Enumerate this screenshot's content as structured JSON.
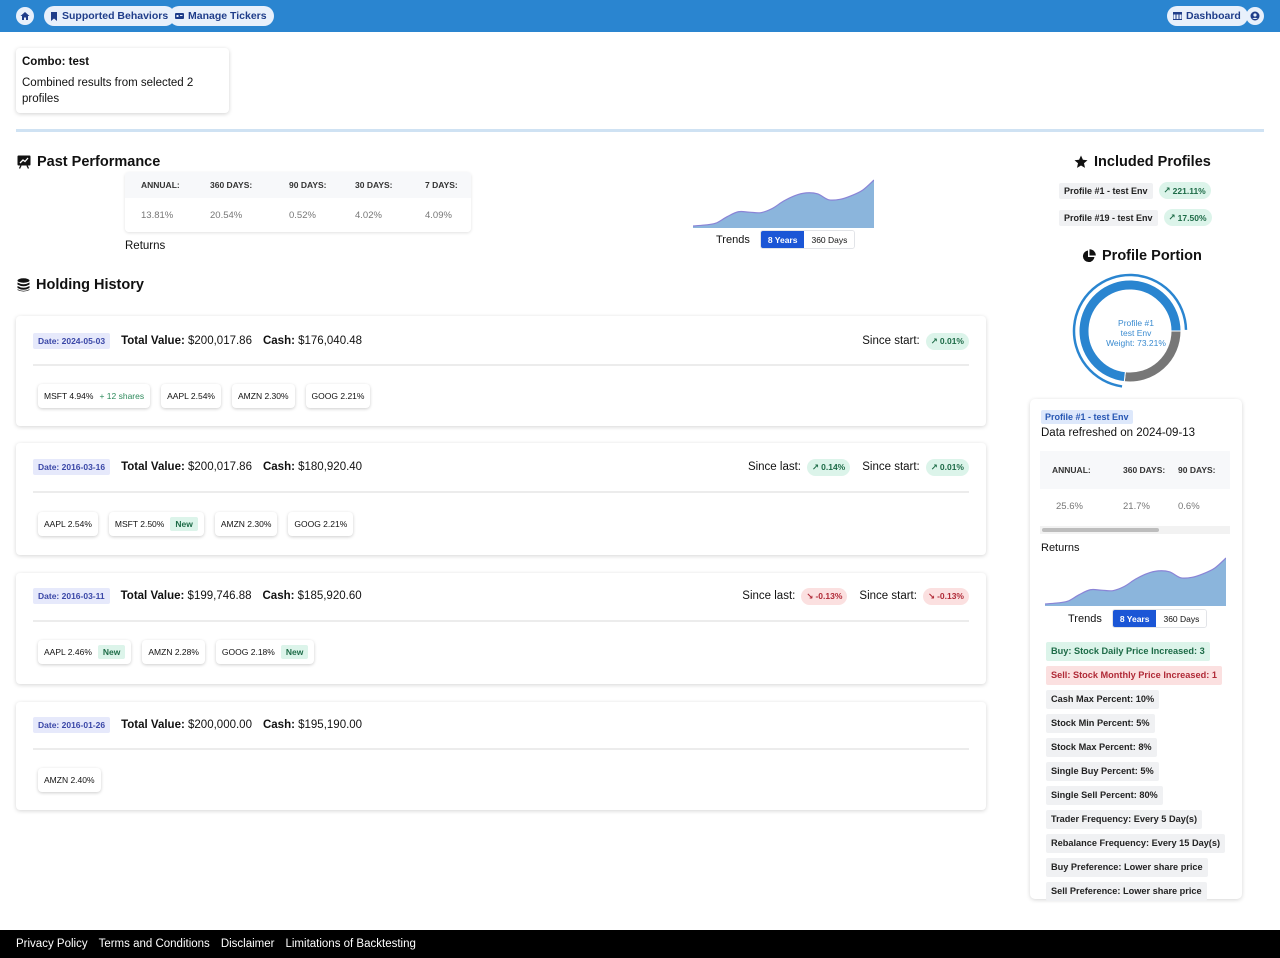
{
  "nav": {
    "home_icon": "home-icon",
    "supported_behaviors": "Supported Behaviors",
    "manage_tickers": "Manage Tickers",
    "dashboard": "Dashboard",
    "account_icon": "user-circle-icon"
  },
  "combo": {
    "title": "Combo: test",
    "description": "Combined results from selected 2 profiles"
  },
  "past_performance": {
    "title": "Past Performance",
    "columns": [
      "ANNUAL:",
      "360 DAYS:",
      "90 DAYS:",
      "30 DAYS:",
      "7 DAYS:"
    ],
    "values": [
      "13.81%",
      "20.54%",
      "0.52%",
      "4.02%",
      "4.09%"
    ],
    "returns_label": "Returns",
    "trends_label": "Trends",
    "trend_options": [
      "8 Years",
      "360 Days"
    ],
    "trend_selected": "8 Years",
    "sparkline": [
      0.0,
      0.02,
      0.06,
      0.2,
      0.31,
      0.3,
      0.29,
      0.38,
      0.54,
      0.66,
      0.72,
      0.7,
      0.57,
      0.58,
      0.66,
      0.78,
      1.0
    ]
  },
  "holding_history": {
    "title": "Holding History",
    "entries": [
      {
        "date": "Date: 2024-05-03",
        "total_value_label": "Total Value:",
        "total_value": "$200,017.86",
        "cash_label": "Cash:",
        "cash": "$176,040.48",
        "since_last": null,
        "since_start": {
          "label": "Since start:",
          "value": "0.01%",
          "direction": "up"
        },
        "holdings": [
          {
            "text": "MSFT 4.94%",
            "note": "+ 12 shares"
          },
          {
            "text": "AAPL 2.54%"
          },
          {
            "text": "AMZN 2.30%"
          },
          {
            "text": "GOOG 2.21%"
          }
        ]
      },
      {
        "date": "Date: 2016-03-16",
        "total_value_label": "Total Value:",
        "total_value": "$200,017.86",
        "cash_label": "Cash:",
        "cash": "$180,920.40",
        "since_last": {
          "label": "Since last:",
          "value": "0.14%",
          "direction": "up"
        },
        "since_start": {
          "label": "Since start:",
          "value": "0.01%",
          "direction": "up"
        },
        "holdings": [
          {
            "text": "AAPL 2.54%"
          },
          {
            "text": "MSFT 2.50%",
            "badge": "New"
          },
          {
            "text": "AMZN 2.30%"
          },
          {
            "text": "GOOG 2.21%"
          }
        ]
      },
      {
        "date": "Date: 2016-03-11",
        "total_value_label": "Total Value:",
        "total_value": "$199,746.88",
        "cash_label": "Cash:",
        "cash": "$185,920.60",
        "since_last": {
          "label": "Since last:",
          "value": "-0.13%",
          "direction": "down"
        },
        "since_start": {
          "label": "Since start:",
          "value": "-0.13%",
          "direction": "down"
        },
        "holdings": [
          {
            "text": "AAPL 2.46%",
            "badge": "New"
          },
          {
            "text": "AMZN 2.28%"
          },
          {
            "text": "GOOG 2.18%",
            "badge": "New"
          }
        ]
      },
      {
        "date": "Date: 2016-01-26",
        "total_value_label": "Total Value:",
        "total_value": "$200,000.00",
        "cash_label": "Cash:",
        "cash": "$195,190.00",
        "since_last": null,
        "since_start": null,
        "holdings": [
          {
            "text": "AMZN 2.40%"
          }
        ]
      }
    ]
  },
  "included_profiles": {
    "title": "Included Profiles",
    "items": [
      {
        "name": "Profile #1 - test Env",
        "return": "221.11%"
      },
      {
        "name": "Profile #19 - test Env",
        "return": "17.50%"
      }
    ]
  },
  "profile_portion": {
    "title": "Profile Portion",
    "center_lines": [
      "Profile #1",
      "test Env",
      "Weight: 73.21%"
    ],
    "slices": [
      {
        "name": "Profile #1 - test Env",
        "weight": 73.21,
        "color": "#2a85d0"
      },
      {
        "name": "Profile #19 - test Env",
        "weight": 26.79,
        "color": "#777777"
      }
    ]
  },
  "profile_detail": {
    "badge": "Profile #1 - test Env",
    "refreshed": "Data refreshed on 2024-09-13",
    "columns": [
      "ANNUAL:",
      "360 DAYS:",
      "90 DAYS:"
    ],
    "values": [
      "25.6%",
      "21.7%",
      "0.6%"
    ],
    "returns_label": "Returns",
    "trends_label": "Trends",
    "trend_options": [
      "8 Years",
      "360 Days"
    ],
    "trend_selected": "8 Years",
    "rules": [
      {
        "text": "Buy: Stock Daily Price Increased: 3",
        "kind": "buy"
      },
      {
        "text": "Sell: Stock Monthly Price Increased: 1",
        "kind": "sell"
      },
      {
        "text": "Cash Max Percent: 10%",
        "kind": "neutral"
      },
      {
        "text": "Stock Min Percent: 5%",
        "kind": "neutral"
      },
      {
        "text": "Stock Max Percent: 8%",
        "kind": "neutral"
      },
      {
        "text": "Single Buy Percent: 5%",
        "kind": "neutral"
      },
      {
        "text": "Single Sell Percent: 80%",
        "kind": "neutral"
      },
      {
        "text": "Trader Frequency: Every 5 Day(s)",
        "kind": "neutral"
      },
      {
        "text": "Rebalance Frequency: Every 15 Day(s)",
        "kind": "neutral"
      },
      {
        "text": "Buy Preference: Lower share price",
        "kind": "neutral"
      },
      {
        "text": "Sell Preference: Lower share price",
        "kind": "neutral"
      }
    ]
  },
  "colors": {
    "navbar": "#2a85d0",
    "accent": "#1b56d6",
    "positive": "#1d6b47",
    "negative": "#b02a37",
    "sparkline_fill": "#8bb5dc",
    "sparkline_line": "#8a84d6"
  },
  "footer": {
    "links": [
      "Privacy Policy",
      "Terms and Conditions",
      "Disclaimer",
      "Limitations of Backtesting"
    ]
  }
}
